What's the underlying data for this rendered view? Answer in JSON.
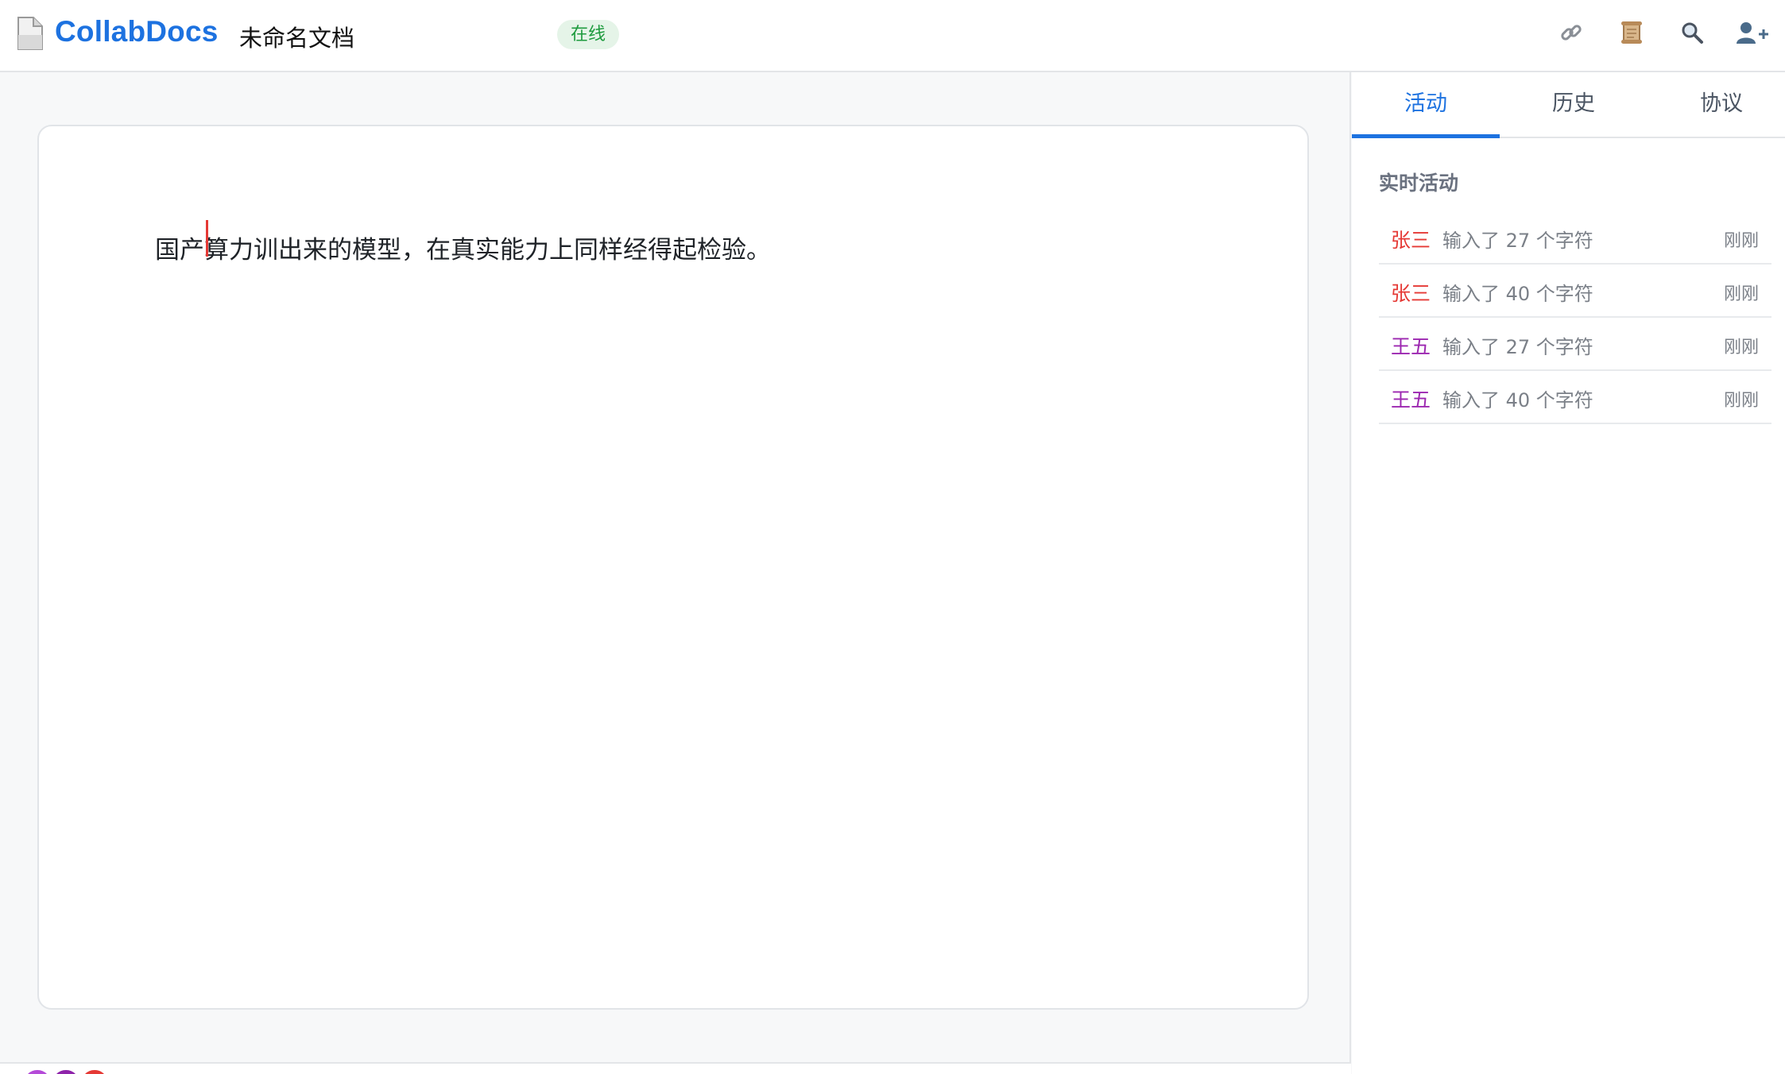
{
  "header": {
    "app_name": "CollabDocs",
    "doc_title": "未命名文档",
    "status": "在线",
    "actions": [
      {
        "name": "link-icon"
      },
      {
        "name": "scroll-icon"
      },
      {
        "name": "search-icon"
      },
      {
        "name": "add-user-icon"
      }
    ]
  },
  "editor": {
    "content": "国产算力训出来的模型，在真实能力上同样经得起检验。"
  },
  "sidebar": {
    "tabs": [
      {
        "label": "活动",
        "active": true
      },
      {
        "label": "历史",
        "active": false
      },
      {
        "label": "协议",
        "active": false
      }
    ],
    "section_title": "实时活动",
    "activities": [
      {
        "user": "张三",
        "action": "输入了 27 个字符",
        "time": "刚刚",
        "color": "#e53935"
      },
      {
        "user": "张三",
        "action": "输入了 40 个字符",
        "time": "刚刚",
        "color": "#e53935"
      },
      {
        "user": "王五",
        "action": "输入了 27 个字符",
        "time": "刚刚",
        "color": "#9c27b0"
      },
      {
        "user": "王五",
        "action": "输入了 40 个字符",
        "time": "刚刚",
        "color": "#9c27b0"
      }
    ]
  },
  "colors": {
    "accent": "#1d72e0",
    "online": "#1e9b3e",
    "user_zhangsan": "#e53935",
    "user_wangwu": "#9c27b0"
  },
  "collaborators": [
    {
      "color": "#b44ad8"
    },
    {
      "color": "#8e24aa"
    },
    {
      "color": "#e53935"
    }
  ]
}
